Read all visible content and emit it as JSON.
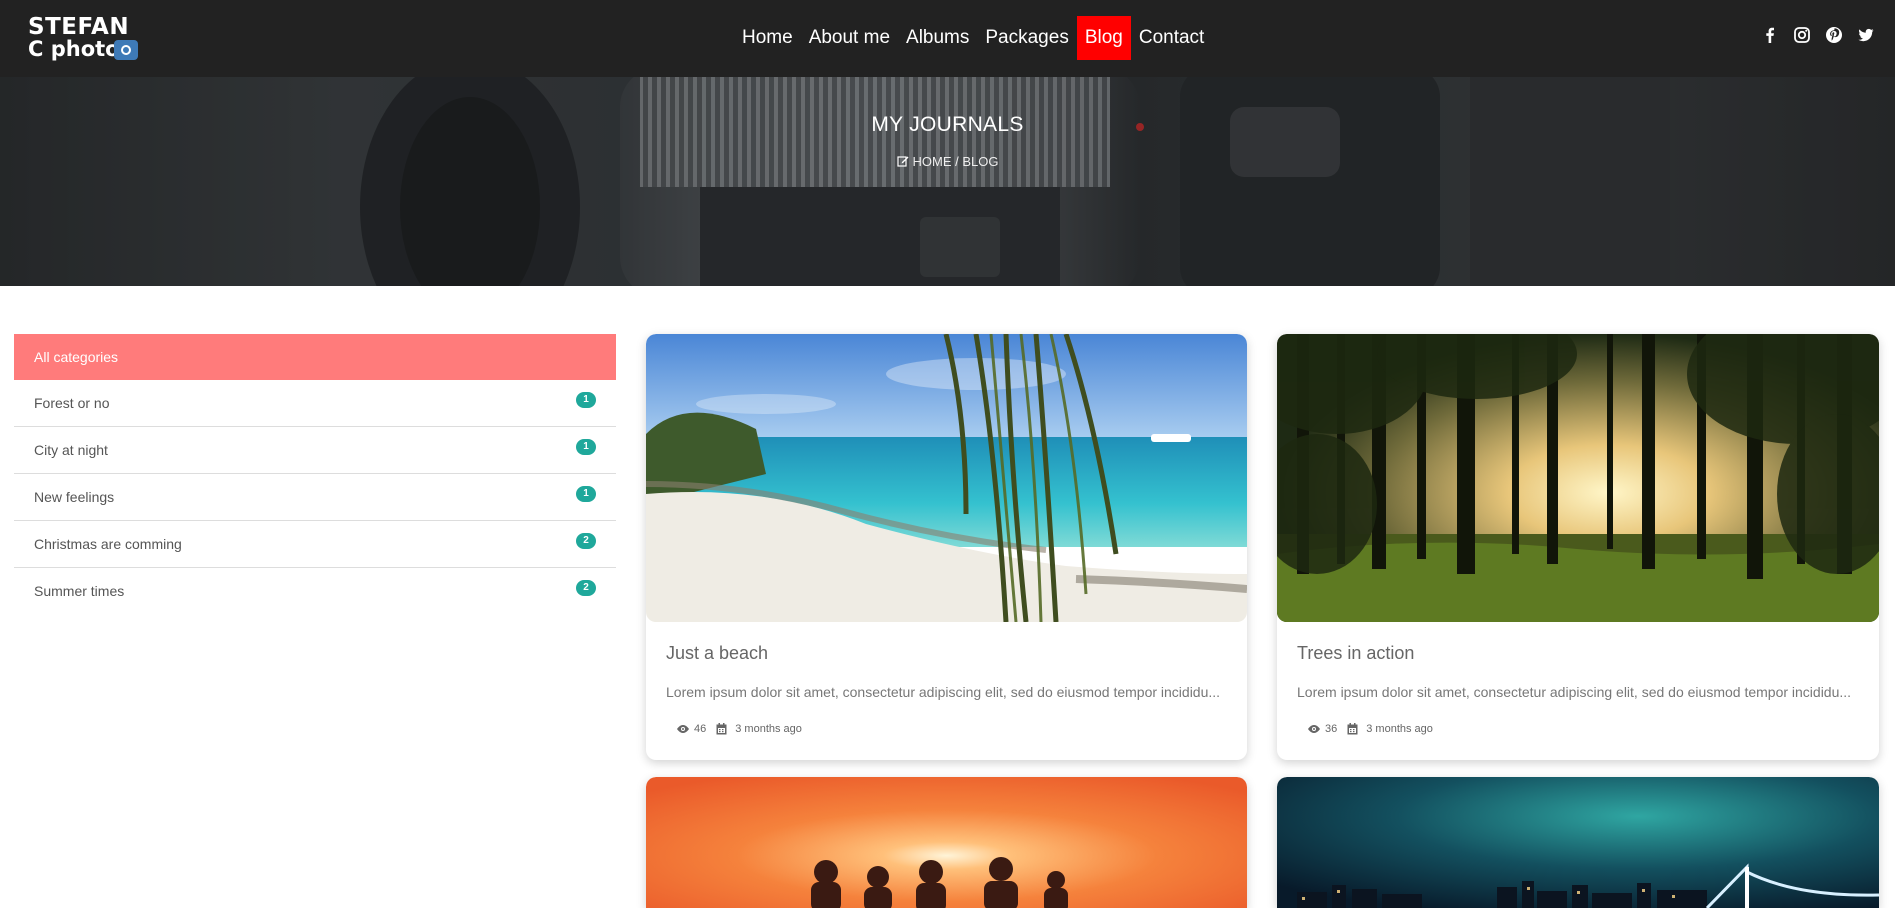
{
  "logo": {
    "line1": "STEFAN",
    "line2": "C photo"
  },
  "nav": {
    "items": [
      {
        "label": "Home",
        "active": false
      },
      {
        "label": "About me",
        "active": false
      },
      {
        "label": "Albums",
        "active": false
      },
      {
        "label": "Packages",
        "active": false
      },
      {
        "label": "Blog",
        "active": true
      },
      {
        "label": "Contact",
        "active": false
      }
    ],
    "active_color": "#ff0000"
  },
  "socials": [
    "facebook-icon",
    "instagram-icon",
    "pinterest-icon",
    "twitter-icon"
  ],
  "hero": {
    "title": "MY JOURNALS",
    "breadcrumb": "HOME / BLOG"
  },
  "sidebar": {
    "header": "All categories",
    "header_color": "#ff7b7b",
    "badge_color": "#1fa89b",
    "categories": [
      {
        "label": "Forest or no",
        "count": "1"
      },
      {
        "label": "City at night",
        "count": "1"
      },
      {
        "label": "New feelings",
        "count": "1"
      },
      {
        "label": "Christmas are comming",
        "count": "2"
      },
      {
        "label": "Summer times",
        "count": "2"
      }
    ]
  },
  "posts": [
    {
      "title": "Just a beach",
      "excerpt": "Lorem ipsum dolor sit amet, consectetur adipiscing elit, sed do eiusmod tempor incididu...",
      "views": "46",
      "date": "3 months ago",
      "image": "beach-photo"
    },
    {
      "title": "Trees in action",
      "excerpt": "Lorem ipsum dolor sit amet, consectetur adipiscing elit, sed do eiusmod tempor incididu...",
      "views": "36",
      "date": "3 months ago",
      "image": "forest-photo"
    },
    {
      "title": "",
      "excerpt": "",
      "views": "",
      "date": "",
      "image": "sunset-photo"
    },
    {
      "title": "",
      "excerpt": "",
      "views": "",
      "date": "",
      "image": "night-city-photo"
    }
  ]
}
